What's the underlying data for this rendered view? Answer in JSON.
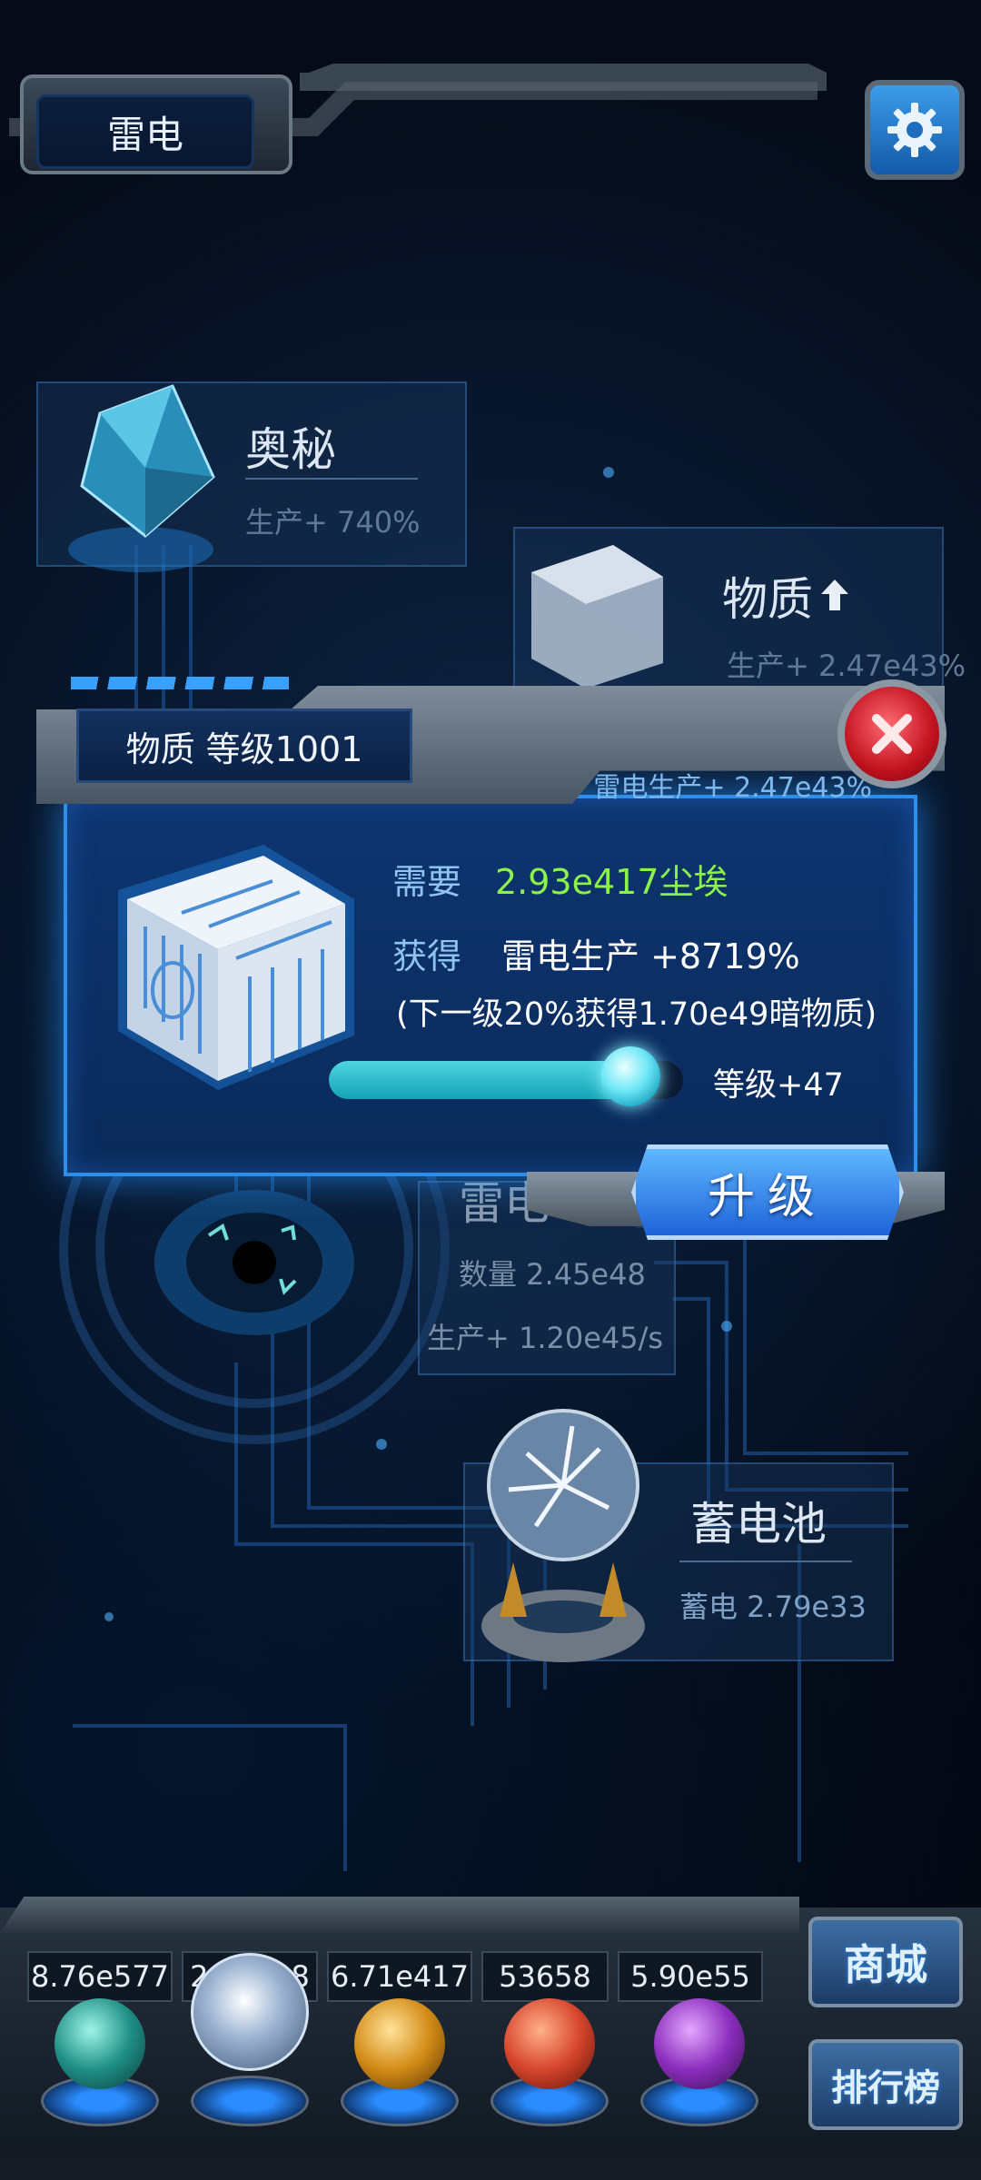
{
  "header": {
    "title": "雷电"
  },
  "nodes": {
    "aomi": {
      "title": "奥秘",
      "sub": "生产+ 740%"
    },
    "wuzhi": {
      "title": "物质",
      "sub": "生产+ 2.47e43%"
    },
    "generator": {
      "title": "雷电",
      "count": "数量 2.45e48",
      "rate": "生产+ 1.20e45/s"
    },
    "battery": {
      "title": "蓄电池",
      "sub": "蓄电 2.79e33"
    }
  },
  "dialog": {
    "title": "物质 等级1001",
    "subtitle": "雷电生产+ 2.47e43%",
    "need_label": "需要",
    "need_value": "2.93e417尘埃",
    "gain_label": "获得",
    "gain_value": "雷电生产 +8719%",
    "next_note": "(下一级20%获得1.70e49暗物质)",
    "progress": 0.85,
    "level_add": "等级+47",
    "upgrade_label": "升级"
  },
  "resources": [
    {
      "value": "8.76e577",
      "color": "#2aa59a"
    },
    {
      "value": "2.45e48",
      "color": "#c9d4e6"
    },
    {
      "value": "6.71e417",
      "color": "#e0a02a"
    },
    {
      "value": "53658",
      "color": "#e3503a"
    },
    {
      "value": "5.90e55",
      "color": "#a23fd1"
    }
  ],
  "side_buttons": {
    "shop": "商城",
    "rank": "排行榜"
  },
  "colors": {
    "accent_green": "#8bf24a",
    "accent_blue": "#2f8fe8"
  }
}
